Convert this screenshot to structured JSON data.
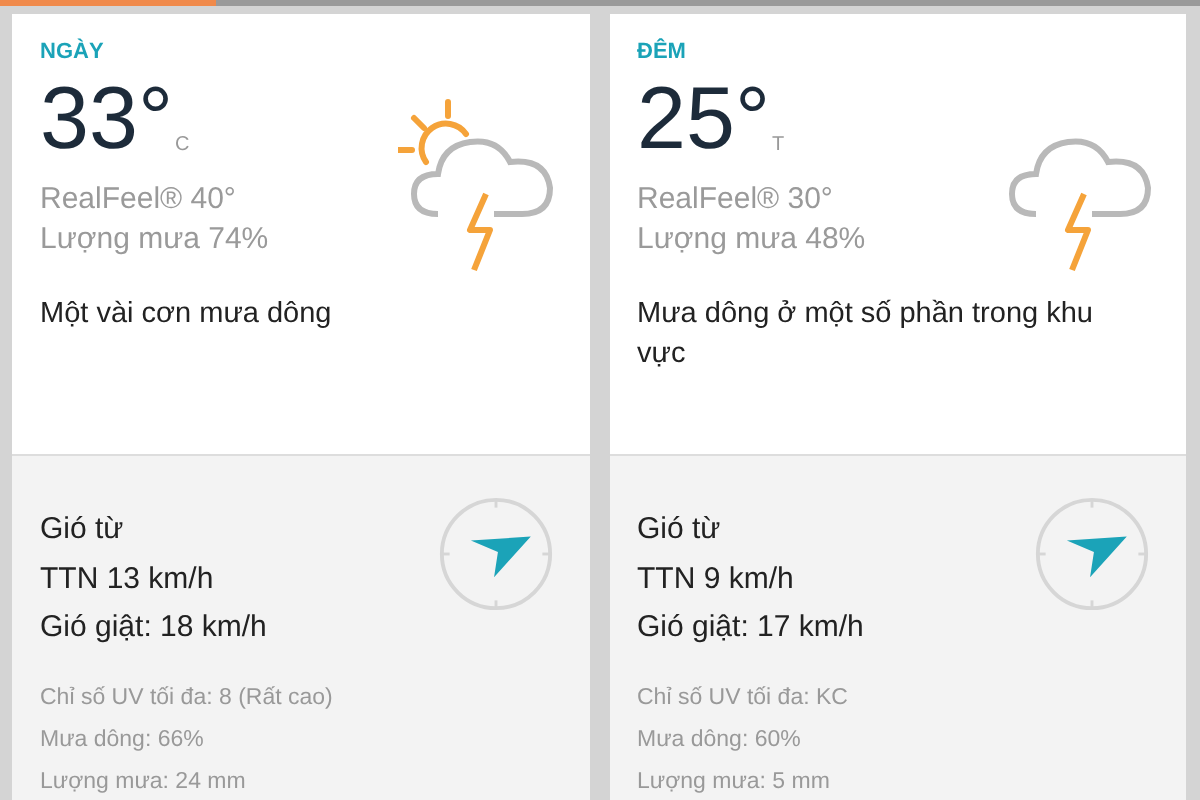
{
  "periods": [
    {
      "label": "NGÀY",
      "temp": "33°",
      "unit": "C",
      "realfeel": "RealFeel® 40°",
      "precip": "Lượng mưa 74%",
      "description": "Một vài cơn mưa dông",
      "kind": "sun-storm",
      "wind_label": "Gió từ",
      "wind": "TTN 13 km/h",
      "gust": "Gió giật: 18 km/h",
      "details": [
        "Chỉ số UV tối đa: 8 (Rất cao)",
        "Mưa dông: 66%",
        "Lượng mưa: 24 mm"
      ]
    },
    {
      "label": "ĐÊM",
      "temp": "25°",
      "unit": "T",
      "realfeel": "RealFeel® 30°",
      "precip": "Lượng mưa 48%",
      "description": "Mưa dông ở một số phần trong khu vực",
      "kind": "storm",
      "wind_label": "Gió từ",
      "wind": "TTN 9 km/h",
      "gust": "Gió giật: 17 km/h",
      "details": [
        "Chỉ số UV tối đa: KC",
        "Mưa dông: 60%",
        "Lượng mưa: 5 mm"
      ]
    }
  ]
}
